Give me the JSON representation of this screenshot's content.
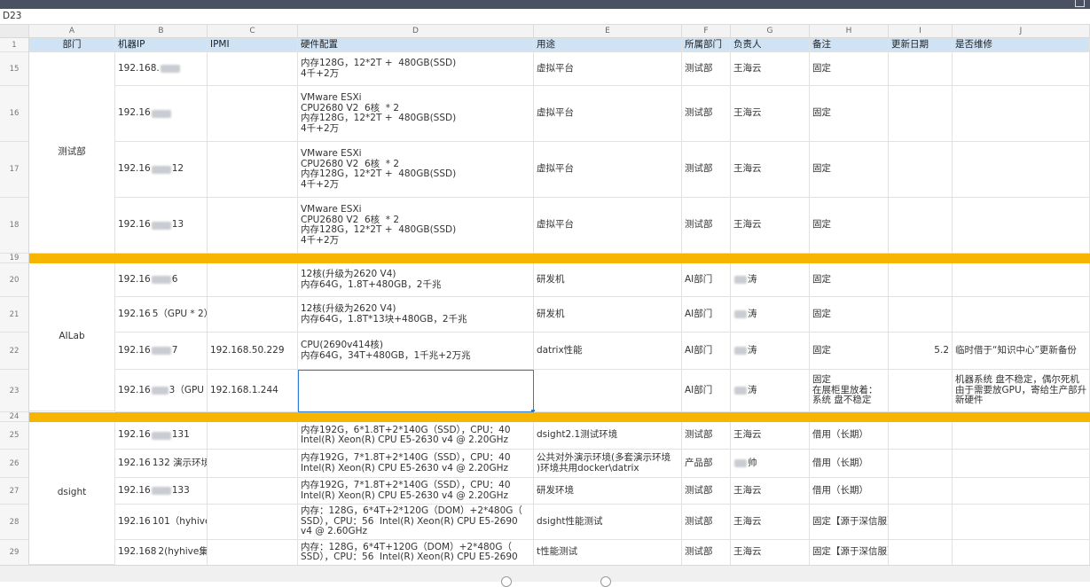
{
  "name_box": "D23",
  "columns": [
    "A",
    "B",
    "C",
    "D",
    "E",
    "F",
    "G",
    "H",
    "I",
    "J"
  ],
  "header": {
    "row_num": "1",
    "dept": "部门",
    "ip": "机器IP",
    "ipmi": "IPMI",
    "hw": "硬件配置",
    "use": "用途",
    "owner_dept": "所属部门",
    "owner": "负责人",
    "note": "备注",
    "date": "更新日期",
    "repair": "是否维修"
  },
  "groups": {
    "test": "测试部",
    "ailab": "AILab",
    "dsight": "dsight"
  },
  "rows": [
    {
      "n": "15",
      "ip": "192.168.",
      "ipmi": "",
      "hw": "内存128G，12*2T +  480GB(SSD)\n4千+2万",
      "use": "虚拟平台",
      "dept": "测试部",
      "owner": "王海云",
      "note": "固定",
      "date": "",
      "repair": ""
    },
    {
      "n": "16",
      "ip": "192.16",
      "ipmi": "",
      "hw": "VMware ESXi\nCPU2680 V2  6核  * 2\n内存128G，12*2T +  480GB(SSD)\n4千+2万",
      "use": "虚拟平台",
      "dept": "测试部",
      "owner": "王海云",
      "note": "固定",
      "date": "",
      "repair": ""
    },
    {
      "n": "17",
      "ip": "192.16",
      "ipsuf": "12",
      "ipmi": "",
      "hw": "VMware ESXi\nCPU2680 V2  6核  * 2\n内存128G，12*2T +  480GB(SSD)\n4千+2万",
      "use": "虚拟平台",
      "dept": "测试部",
      "owner": "王海云",
      "note": "固定",
      "date": "",
      "repair": ""
    },
    {
      "n": "18",
      "ip": "192.16",
      "ipsuf": "13",
      "ipmi": "",
      "hw": "VMware ESXi\nCPU2680 V2  6核  * 2\n内存128G，12*2T +  480GB(SSD)\n4千+2万",
      "use": "虚拟平台",
      "dept": "测试部",
      "owner": "王海云",
      "note": "固定",
      "date": "",
      "repair": ""
    },
    {
      "n": "19",
      "sep": true
    },
    {
      "n": "20",
      "ip": "192.16",
      "ipsuf": "6",
      "ipmi": "",
      "hw": "12核(升级为2620 V4)\n内存64G，1.8T+480GB，2千兆",
      "use": "研发机",
      "dept": "AI部门",
      "owner": "涛",
      "note": "固定",
      "date": "",
      "repair": ""
    },
    {
      "n": "21",
      "ip": "192.16",
      "ipsuf": "5（GPU * 2）",
      "ipmi": "",
      "hw": "12核(升级为2620 V4)\n内存64G，1.8T*13块+480GB，2千兆",
      "use": "研发机",
      "dept": "AI部门",
      "owner": "涛",
      "note": "固定",
      "date": "",
      "repair": ""
    },
    {
      "n": "22",
      "ip": "192.16",
      "ipsuf": "7",
      "ipmi": "192.168.50.229",
      "hw": "CPU(2690v414核)\n内存64G，34T+480GB，1千兆+2万兆",
      "use": "datrix性能",
      "dept": "AI部门",
      "owner": "涛",
      "note": "固定",
      "date": "5.2",
      "repair": "临时借于“知识中心”更新备份"
    },
    {
      "n": "23",
      "ip": "192.16",
      "ipsuf": "3（GPU",
      "ipmi": "192.168.1.244",
      "hw": "",
      "use": "",
      "dept": "AI部门",
      "owner": "涛",
      "note": "固定\n在展柜里放着：\n系统 盘不稳定",
      "date": "",
      "repair": "机器系统 盘不稳定，偶尔死机\n由于需要放GPU，寄给生产部升\n新硬件"
    },
    {
      "n": "24",
      "sep": true
    },
    {
      "n": "25",
      "ip": "192.16",
      "ipsuf": "131",
      "ipmi": "",
      "hw": "内存192G，6*1.8T+2*140G（SSD），CPU：40\nIntel(R) Xeon(R) CPU E5-2630 v4 @ 2.20GHz",
      "use": "dsight2.1测试环境",
      "dept": "测试部",
      "owner": "王海云",
      "note": "借用（长期）",
      "date": "",
      "repair": ""
    },
    {
      "n": "26",
      "ip": "192.16",
      "ipsuf": "132 演示环境",
      "ipmi": "",
      "hw": "内存192G，7*1.8T+2*140G（SSD），CPU：40\nIntel(R) Xeon(R) CPU E5-2630 v4 @ 2.20GHz",
      "use": "公共对外演示环境(多套演示环境\n)环境共用docker\\datrix",
      "dept": "产品部",
      "owner": "帅",
      "note": "借用（长期）",
      "date": "",
      "repair": ""
    },
    {
      "n": "27",
      "ip": "192.16",
      "ipsuf": "133",
      "ipmi": "",
      "hw": "内存192G，7*1.8T+2*140G（SSD），CPU：40\nIntel(R) Xeon(R) CPU E5-2630 v4 @ 2.20GHz",
      "use": "研发环境",
      "dept": "测试部",
      "owner": "王海云",
      "note": "借用（长期）",
      "date": "",
      "repair": ""
    },
    {
      "n": "28",
      "ip": "192.16",
      "ipsuf": "101（hyhive集群）",
      "ipmi": "",
      "hw": "内存：128G，6*4T+2*120G（DOM）+2*480G（\nSSD），CPU：56  Intel(R) Xeon(R) CPU E5-2690\nv4 @ 2.60GHz",
      "use": "dsight性能测试",
      "dept": "测试部",
      "owner": "王海云",
      "note": "固定【源于深信服】",
      "date": "",
      "repair": ""
    },
    {
      "n": "29",
      "ip": "192.168",
      "ipsuf": "2(hyhive集群)",
      "ipmi": "",
      "hw": "内存：128G，6*4T+120G（DOM）+2*480G（\nSSD），CPU：56  Intel(R) Xeon(R) CPU E5-2690",
      "use": "t性能测试",
      "dept": "测试部",
      "owner": "王海云",
      "note": "固定【源于深信服】",
      "date": "",
      "repair": ""
    }
  ]
}
